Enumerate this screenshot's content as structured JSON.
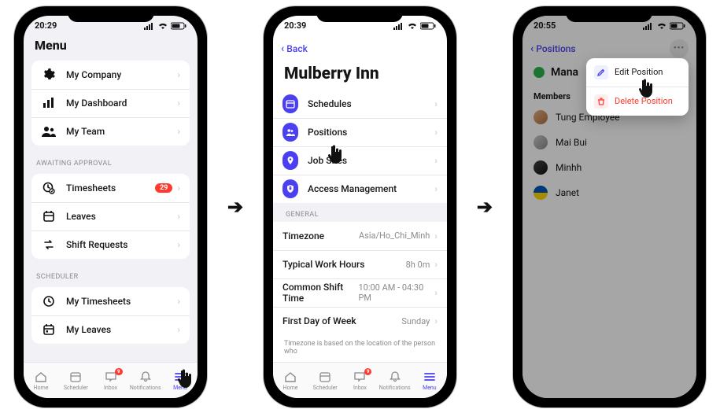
{
  "screen1": {
    "time": "20:29",
    "title": "Menu",
    "group1": [
      {
        "icon": "gear",
        "label": "My Company"
      },
      {
        "icon": "bars",
        "label": "My Dashboard"
      },
      {
        "icon": "team",
        "label": "My Team"
      }
    ],
    "awaiting_label": "AWAITING APPROVAL",
    "awaiting": [
      {
        "icon": "timesheet",
        "label": "Timesheets",
        "badge": "29"
      },
      {
        "icon": "leave",
        "label": "Leaves"
      },
      {
        "icon": "swap",
        "label": "Shift Requests"
      }
    ],
    "scheduler_label": "SCHEDULER",
    "scheduler": [
      {
        "icon": "clock",
        "label": "My Timesheets"
      },
      {
        "icon": "calendar",
        "label": "My Leaves"
      }
    ]
  },
  "screen2": {
    "time": "20:39",
    "back": "Back",
    "company": "Mulberry Inn",
    "primary": [
      {
        "icon": "sched",
        "label": "Schedules"
      },
      {
        "icon": "people",
        "label": "Positions"
      },
      {
        "icon": "pin",
        "label": "Job Sites"
      },
      {
        "icon": "shield",
        "label": "Access Management"
      }
    ],
    "general_label": "GENERAL",
    "general": [
      {
        "label": "Timezone",
        "value": "Asia/Ho_Chi_Minh"
      },
      {
        "label": "Typical Work Hours",
        "value": "8h 0m"
      },
      {
        "label": "Common Shift Time",
        "value": "10:00 AM  -  04:30 PM"
      },
      {
        "label": "First Day of Week",
        "value": "Sunday"
      }
    ],
    "footnote": "Timezone is based on the location of the person who"
  },
  "screen3": {
    "time": "20:55",
    "back": "Positions",
    "position_color": "#2BB24C",
    "position_name": "Mana",
    "members_label": "Members",
    "members": [
      "Tung Employee",
      "Mai Bui",
      "Minhh",
      "Janet"
    ],
    "menu_edit": "Edit Position",
    "menu_delete": "Delete Position"
  },
  "tabbar": {
    "items": [
      "Home",
      "Scheduler",
      "Inbox",
      "Notifications",
      "Menu"
    ],
    "inbox_badge": "9"
  }
}
